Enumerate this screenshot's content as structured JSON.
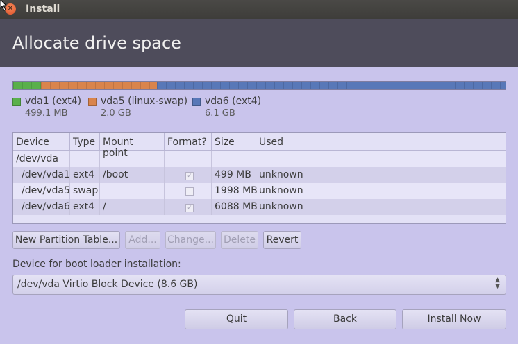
{
  "window": {
    "title": "Install"
  },
  "page": {
    "title": "Allocate drive space"
  },
  "colors": {
    "vda1": "#5ab04b",
    "vda5": "#d9844c",
    "vda6": "#5878b8"
  },
  "partitions_legend": [
    {
      "name": "vda1 (ext4)",
      "size": "499.1 MB"
    },
    {
      "name": "vda5 (linux-swap)",
      "size": "2.0 GB"
    },
    {
      "name": "vda6 (ext4)",
      "size": "6.1 GB"
    }
  ],
  "table": {
    "headers": [
      "Device",
      "Type",
      "Mount point",
      "Format?",
      "Size",
      "Used"
    ],
    "disk_row": "/dev/vda",
    "rows": [
      {
        "device": "/dev/vda1",
        "type": "ext4",
        "mount": "/boot",
        "format": true,
        "size": "499 MB",
        "used": "unknown"
      },
      {
        "device": "/dev/vda5",
        "type": "swap",
        "mount": "",
        "format": false,
        "size": "1998 MB",
        "used": "unknown"
      },
      {
        "device": "/dev/vda6",
        "type": "ext4",
        "mount": "/",
        "format": true,
        "size": "6088 MB",
        "used": "unknown"
      }
    ]
  },
  "actions": {
    "new_table": "New Partition Table...",
    "add": "Add...",
    "change": "Change...",
    "delete": "Delete",
    "revert": "Revert"
  },
  "bootloader": {
    "label": "Device for boot loader installation:",
    "selected": "/dev/vda Virtio Block Device (8.6 GB)"
  },
  "nav": {
    "quit": "Quit",
    "back": "Back",
    "install": "Install Now"
  }
}
